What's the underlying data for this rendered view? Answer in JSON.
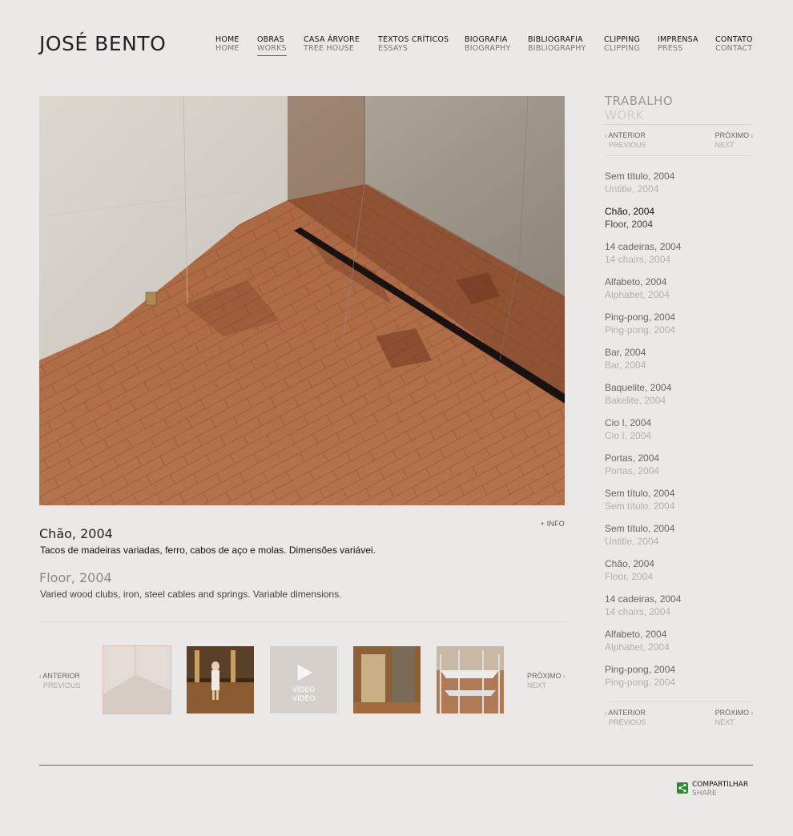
{
  "site": {
    "logo": "JOSÉ BENTO"
  },
  "nav": [
    {
      "pt": "HOME",
      "en": "HOME"
    },
    {
      "pt": "OBRAS",
      "en": "WORKS",
      "active": true
    },
    {
      "pt": "CASA ÁRVORE",
      "en": "TREE HOUSE"
    },
    {
      "pt": "TEXTOS CRÍTICOS",
      "en": "ESSAYS"
    },
    {
      "pt": "BIOGRAFIA",
      "en": "BIOGRAPHY"
    },
    {
      "pt": "BIBLIOGRAFIA",
      "en": "BIBLIOGRAPHY"
    },
    {
      "pt": "CLIPPING",
      "en": "CLIPPING"
    },
    {
      "pt": "IMPRENSA",
      "en": "PRESS"
    },
    {
      "pt": "CONTATO",
      "en": "CONTACT"
    }
  ],
  "artwork": {
    "info_link": "+ INFO",
    "title_pt": "Chão, 2004",
    "desc_pt": "Tacos de madeiras variadas, ferro, cabos de aço e molas. Dimensões variávei.",
    "title_en": "Floor, 2004",
    "desc_en": "Varied wood clubs, iron, steel cables and springs. Variable dimensions."
  },
  "thumbs_nav": {
    "prev_pt": "ANTERIOR",
    "prev_en": "PREVIOUS",
    "next_pt": "PRÓXIMO",
    "next_en": "NEXT",
    "video_label_1": "VÍDEO",
    "video_label_2": "VIDEO"
  },
  "sidebar": {
    "heading_pt": "TRABALHO",
    "heading_en": "WORK",
    "prev_pt": "ANTERIOR",
    "prev_en": "PREVIOUS",
    "next_pt": "PRÓXIMO",
    "next_en": "NEXT",
    "works": [
      {
        "pt": "Sem título, 2004",
        "en": "Untitle, 2004"
      },
      {
        "pt": "Chão, 2004",
        "en": "Floor, 2004",
        "current": true
      },
      {
        "pt": "14 cadeiras, 2004",
        "en": "14 chairs, 2004"
      },
      {
        "pt": "Alfabeto, 2004",
        "en": "Alphabet, 2004"
      },
      {
        "pt": "Ping-pong, 2004",
        "en": "Ping-pong, 2004"
      },
      {
        "pt": "Bar, 2004",
        "en": "Bar, 2004"
      },
      {
        "pt": "Baquelite, 2004",
        "en": "Bakelite, 2004"
      },
      {
        "pt": "Cio I, 2004",
        "en": "Cio I, 2004"
      },
      {
        "pt": "Portas, 2004",
        "en": "Portas, 2004"
      },
      {
        "pt": "Sem título, 2004",
        "en": "Sem título, 2004"
      },
      {
        "pt": "Sem título, 2004",
        "en": "Untitle, 2004"
      },
      {
        "pt": "Chão, 2004",
        "en": "Floor, 2004"
      },
      {
        "pt": "14 cadeiras, 2004",
        "en": "14 chairs, 2004"
      },
      {
        "pt": "Alfabeto, 2004",
        "en": "Alphabet, 2004"
      },
      {
        "pt": "Ping-pong, 2004",
        "en": "Ping-pong, 2004"
      }
    ]
  },
  "share": {
    "pt": "COMPARTILHAR",
    "en": "SHARE"
  },
  "colors": {
    "background": "#ebe9e8",
    "accent_red": "#c9363b",
    "share_green": "#2e8a2e"
  }
}
